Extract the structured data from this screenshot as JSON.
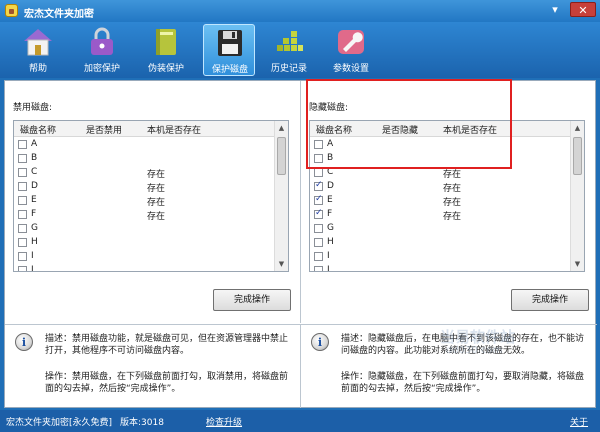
{
  "window": {
    "title": "宏杰文件夹加密",
    "minimize_glyph": "▾",
    "close_glyph": "✕"
  },
  "toolbar": {
    "items": [
      {
        "label": "帮助",
        "icon": "house-icon"
      },
      {
        "label": "加密保护",
        "icon": "lock-icon"
      },
      {
        "label": "伪装保护",
        "icon": "book-icon"
      },
      {
        "label": "保护磁盘",
        "icon": "floppy-disk-icon",
        "active": true
      },
      {
        "label": "历史记录",
        "icon": "grid-history-icon"
      },
      {
        "label": "参数设置",
        "icon": "wrench-icon"
      }
    ]
  },
  "disable_panel": {
    "title": "禁用磁盘:",
    "columns": [
      "磁盘名称",
      "是否禁用",
      "本机是否存在"
    ],
    "rows": [
      {
        "drive": "A",
        "checked": false,
        "status": ""
      },
      {
        "drive": "B",
        "checked": false,
        "status": ""
      },
      {
        "drive": "C",
        "checked": false,
        "status": "存在"
      },
      {
        "drive": "D",
        "checked": false,
        "status": "存在"
      },
      {
        "drive": "E",
        "checked": false,
        "status": "存在"
      },
      {
        "drive": "F",
        "checked": false,
        "status": "存在"
      },
      {
        "drive": "G",
        "checked": false,
        "status": ""
      },
      {
        "drive": "H",
        "checked": false,
        "status": ""
      },
      {
        "drive": "I",
        "checked": false,
        "status": ""
      },
      {
        "drive": "J",
        "checked": false,
        "status": ""
      }
    ],
    "button": "完成操作"
  },
  "hide_panel": {
    "title": "隐藏磁盘:",
    "columns": [
      "磁盘名称",
      "是否隐藏",
      "本机是否存在"
    ],
    "rows": [
      {
        "drive": "A",
        "checked": false,
        "status": ""
      },
      {
        "drive": "B",
        "checked": false,
        "status": ""
      },
      {
        "drive": "C",
        "checked": false,
        "status": "存在"
      },
      {
        "drive": "D",
        "checked": true,
        "status": "存在"
      },
      {
        "drive": "E",
        "checked": true,
        "status": "存在"
      },
      {
        "drive": "F",
        "checked": true,
        "status": "存在"
      },
      {
        "drive": "G",
        "checked": false,
        "status": ""
      },
      {
        "drive": "H",
        "checked": false,
        "status": ""
      },
      {
        "drive": "I",
        "checked": false,
        "status": ""
      },
      {
        "drive": "J",
        "checked": false,
        "status": ""
      }
    ],
    "button": "完成操作"
  },
  "info_left": {
    "desc": "描述：禁用磁盘功能，就是磁盘可见，但在资源管理器中禁止打开，其他程序不可访问磁盘内容。",
    "op": "操作：禁用磁盘，在下列磁盘前面打勾，取消禁用，将磁盘前面的勾去掉，然后按“完成操作”。"
  },
  "info_right": {
    "desc": "描述：隐藏磁盘后，在电脑中看不到该磁盘的存在，也不能访问磁盘的内容。此功能对系统所在的磁盘无效。",
    "op": "操作：隐藏磁盘，在下列磁盘前面打勾，要取消隐藏，将磁盘前面的勾去掉，然后按“完成操作”。"
  },
  "watermark": {
    "main": "当易软件站",
    "sub": "dd030.com"
  },
  "statusbar": {
    "app": "宏杰文件夹加密[永久免费]",
    "version": "版本:3018",
    "check_update": "检查升级",
    "about": "关于"
  }
}
